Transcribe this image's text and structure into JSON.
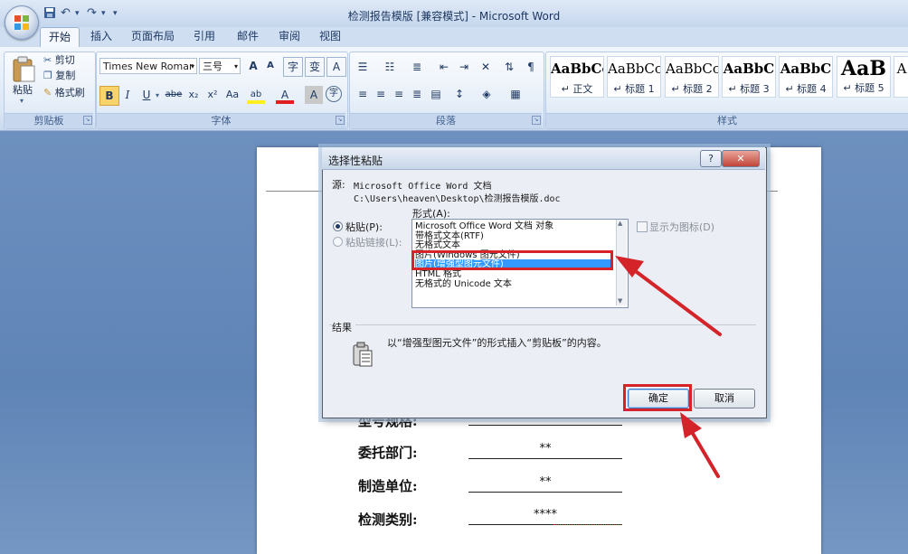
{
  "window": {
    "title": "检测报告模版 [兼容模式] - Microsoft Word",
    "qat_icons": [
      "save-icon",
      "undo-icon",
      "redo-icon",
      "customize-qat-icon"
    ]
  },
  "tabs": [
    "开始",
    "插入",
    "页面布局",
    "引用",
    "邮件",
    "审阅",
    "视图"
  ],
  "ribbon": {
    "clipboard": {
      "paste": "粘贴",
      "cut": "剪切",
      "copy": "复制",
      "format_painter": "格式刷",
      "label": "剪贴板"
    },
    "font": {
      "name": "Times New Romar",
      "size": "三号",
      "label": "字体",
      "buttons": [
        "B",
        "I",
        "U",
        "abe",
        "x₂",
        "x²",
        "Aa",
        "ab",
        "A",
        "A",
        "字"
      ],
      "top_buttons": [
        "A",
        "A",
        "字",
        "变",
        "A"
      ]
    },
    "paragraph": {
      "label": "段落"
    },
    "styles": {
      "label": "样式",
      "items": [
        {
          "sample": "AaBbCc",
          "name": "↵ 正文"
        },
        {
          "sample": "AaBbCc",
          "name": "↵ 标题 1"
        },
        {
          "sample": "AaBbCc",
          "name": "↵ 标题 2"
        },
        {
          "sample": "AaBbC",
          "name": "↵ 标题 3"
        },
        {
          "sample": "AaBbC",
          "name": "↵ 标题 4"
        },
        {
          "sample": "AaB",
          "name": "↵ 标题 5"
        },
        {
          "sample": "A",
          "name": ""
        }
      ]
    }
  },
  "document": {
    "rows": [
      {
        "label": "型号规格:",
        "value": "****"
      },
      {
        "label": "委托部门:",
        "value": "**"
      },
      {
        "label": "制造单位:",
        "value": "**"
      },
      {
        "label": "检测类别:",
        "value": "****"
      }
    ]
  },
  "dialog": {
    "title": "选择性粘贴",
    "help": "?",
    "close": "✕",
    "source_label": "源:",
    "source_line1": "Microsoft Office Word 文档",
    "source_line2": "C:\\Users\\heaven\\Desktop\\检测报告模版.doc",
    "format_label": "形式(A):",
    "paste_radio": "粘贴(P):",
    "paste_link_radio": "粘贴链接(L):",
    "display_as_icon": "显示为图标(D)",
    "formats": [
      "Microsoft Office Word 文档 对象",
      "带格式文本(RTF)",
      "无格式文本",
      "图片(Windows 图元文件)",
      "图片(增强型图元文件)",
      "HTML 格式",
      "无格式的 Unicode 文本"
    ],
    "selected_index": 4,
    "result_label": "结果",
    "result_text": "以“增强型图元文件”的形式插入“剪贴板”的内容。",
    "ok": "确定",
    "cancel": "取消"
  },
  "annotation_color": "#d5232a"
}
